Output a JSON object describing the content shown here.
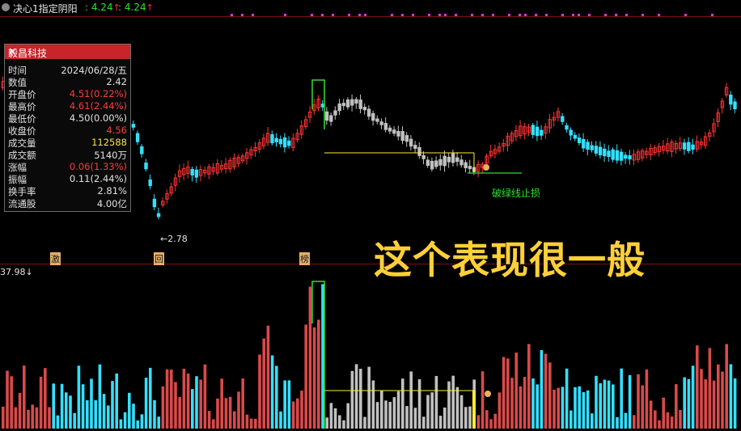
{
  "topbar": {
    "title": "决心1指定阴阳",
    "value1": ": 4.24",
    "value2": ": 4.24",
    "up_arrow": "↑"
  },
  "panel": {
    "name": "毅昌科技",
    "close": "✕",
    "rows": [
      {
        "k": "时间",
        "v": "2024/06/28/五",
        "color": "#e0e0e0"
      },
      {
        "k": "数值",
        "v": "2.42",
        "color": "#e0e0e0"
      },
      {
        "k": "开盘价",
        "v": "4.51(0.22%)",
        "color": "#ff3b3b"
      },
      {
        "k": "最高价",
        "v": "4.61(2.44%)",
        "color": "#ff3b3b"
      },
      {
        "k": "最低价",
        "v": "4.50(0.00%)",
        "color": "#e0e0e0"
      },
      {
        "k": "收盘价",
        "v": "4.56",
        "color": "#ff3b3b"
      },
      {
        "k": "成交量",
        "v": "112588",
        "color": "#f2e34a"
      },
      {
        "k": "成交额",
        "v": "5140万",
        "color": "#e0e0e0"
      },
      {
        "k": "涨幅",
        "v": "0.06(1.33%)",
        "color": "#ff3b3b"
      },
      {
        "k": "振幅",
        "v": "0.11(2.44%)",
        "color": "#e0e0e0"
      },
      {
        "k": "换手率",
        "v": "2.81%",
        "color": "#e0e0e0"
      },
      {
        "k": "流通股",
        "v": "4.00亿",
        "color": "#e0e0e0"
      }
    ]
  },
  "chart": {
    "low_label": "←2.78",
    "stop_loss_label": "破绿线止损",
    "big_caption": "这个表现很一般",
    "tags": [
      "激",
      "回",
      "榜"
    ],
    "volume_label": "37.98↓",
    "colors": {
      "up": "#ff3333",
      "down": "#33e0ff",
      "gray": "#c0c0c0",
      "yellow": "#ffee33",
      "green": "#33dd33",
      "magenta": "#dd33dd"
    }
  }
}
